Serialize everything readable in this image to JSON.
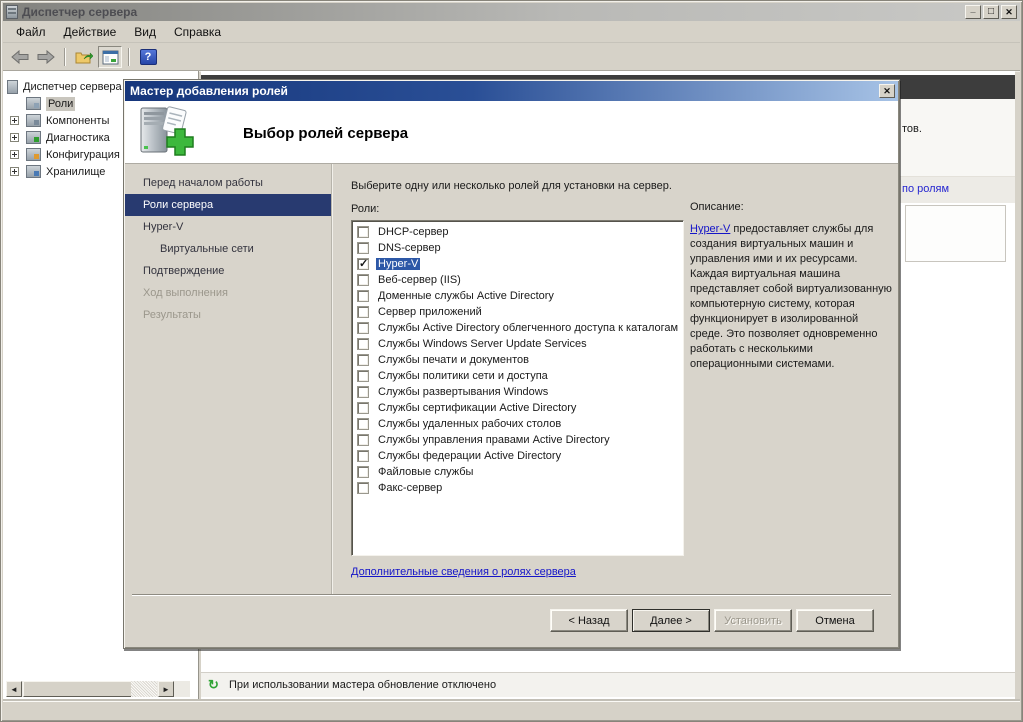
{
  "window": {
    "title": "Диспетчер сервера",
    "menu": [
      "Файл",
      "Действие",
      "Вид",
      "Справка"
    ],
    "status_note": "При использовании мастера обновление отключено"
  },
  "tree": {
    "root": "Диспетчер сервера",
    "items": [
      {
        "label": "Роли",
        "selected": true,
        "expandable": false
      },
      {
        "label": "Компоненты",
        "selected": false,
        "expandable": true
      },
      {
        "label": "Диагностика",
        "selected": false,
        "expandable": true
      },
      {
        "label": "Конфигурация",
        "selected": false,
        "expandable": true
      },
      {
        "label": "Хранилище",
        "selected": false,
        "expandable": true
      }
    ]
  },
  "content_pane": {
    "clipped_description": "тов.",
    "clipped_link": "по ролям"
  },
  "wizard": {
    "title": "Мастер добавления ролей",
    "page_title": "Выбор ролей сервера",
    "steps": [
      {
        "label": "Перед началом работы",
        "state": "normal"
      },
      {
        "label": "Роли сервера",
        "state": "selected"
      },
      {
        "label": "Hyper-V",
        "state": "normal"
      },
      {
        "label": "Виртуальные сети",
        "state": "normal",
        "indent": true
      },
      {
        "label": "Подтверждение",
        "state": "normal"
      },
      {
        "label": "Ход выполнения",
        "state": "disabled"
      },
      {
        "label": "Результаты",
        "state": "disabled"
      }
    ],
    "instruction": "Выберите одну или несколько ролей для установки на сервер.",
    "roles_label": "Роли:",
    "roles": [
      {
        "label": "DHCP-сервер",
        "checked": false
      },
      {
        "label": "DNS-сервер",
        "checked": false
      },
      {
        "label": "Hyper-V",
        "checked": true,
        "selected": true
      },
      {
        "label": "Веб-сервер (IIS)",
        "checked": false
      },
      {
        "label": "Доменные службы Active Directory",
        "checked": false
      },
      {
        "label": "Сервер приложений",
        "checked": false
      },
      {
        "label": "Службы Active Directory облегченного доступа к каталогам",
        "checked": false
      },
      {
        "label": "Службы Windows Server Update Services",
        "checked": false
      },
      {
        "label": "Службы печати и документов",
        "checked": false
      },
      {
        "label": "Службы политики сети и доступа",
        "checked": false
      },
      {
        "label": "Службы развертывания Windows",
        "checked": false
      },
      {
        "label": "Службы сертификации Active Directory",
        "checked": false
      },
      {
        "label": "Службы удаленных рабочих столов",
        "checked": false
      },
      {
        "label": "Службы управления правами Active Directory",
        "checked": false
      },
      {
        "label": "Службы федерации Active Directory",
        "checked": false
      },
      {
        "label": "Файловые службы",
        "checked": false
      },
      {
        "label": "Факс-сервер",
        "checked": false
      }
    ],
    "description": {
      "heading": "Описание:",
      "link_text": "Hyper-V",
      "body": " предоставляет службы для создания виртуальных машин и управления ими и их ресурсами. Каждая виртуальная машина представляет собой виртуализованную компьютерную систему, которая функционирует в изолированной среде. Это позволяет одновременно работать с несколькими операционными системами."
    },
    "more_info_link": "Дополнительные сведения о ролях сервера",
    "buttons": {
      "back": "< Назад",
      "next": "Далее >",
      "install": "Установить",
      "cancel": "Отмена"
    },
    "colors": {
      "title_gradient_start": "#16367b",
      "title_gradient_end": "#a7c3e6",
      "selected_step_bg": "#283a70",
      "selection_blue": "#2d58a7",
      "link_blue": "#1515c8"
    }
  }
}
